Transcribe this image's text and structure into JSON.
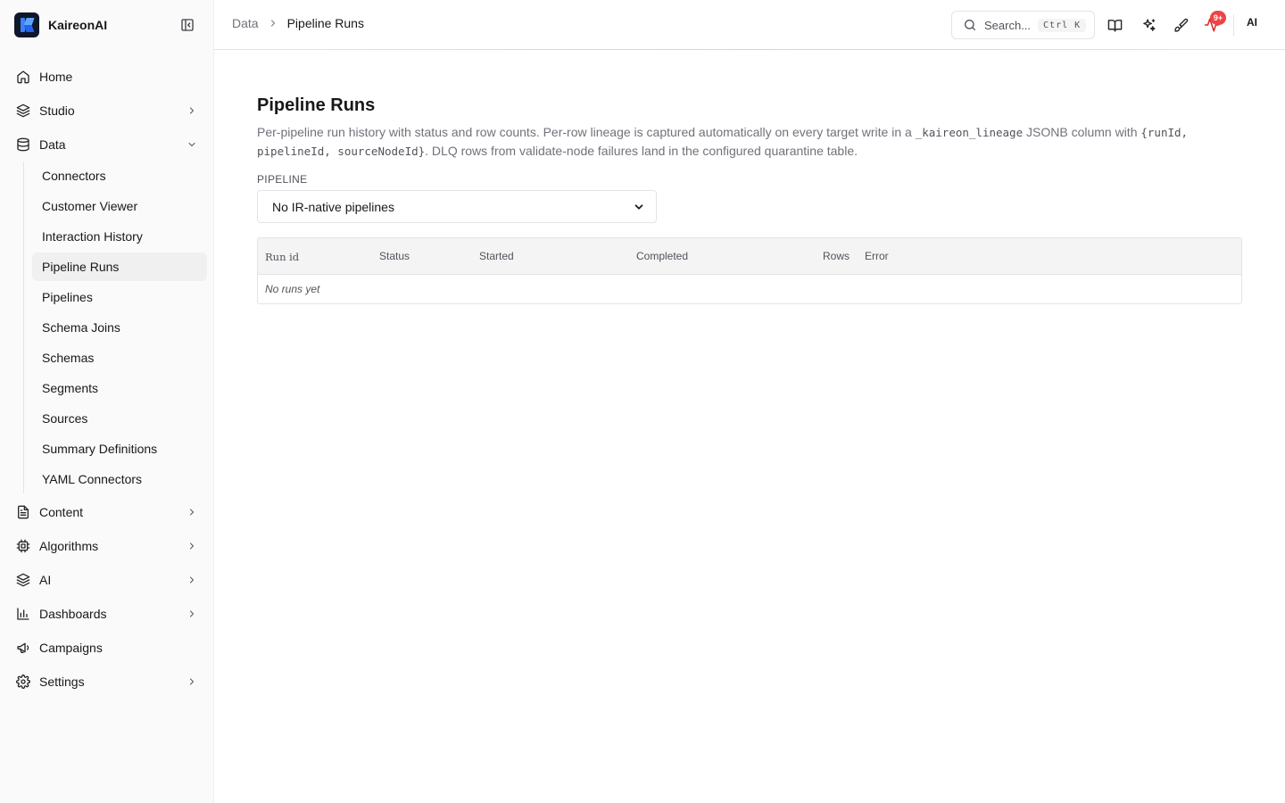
{
  "app": {
    "name": "KaireonAI"
  },
  "sidebar": {
    "items": [
      {
        "label": "Home"
      },
      {
        "label": "Studio"
      },
      {
        "label": "Data"
      },
      {
        "label": "Content"
      },
      {
        "label": "Algorithms"
      },
      {
        "label": "AI"
      },
      {
        "label": "Dashboards"
      },
      {
        "label": "Campaigns"
      },
      {
        "label": "Settings"
      }
    ],
    "data_subitems": [
      {
        "label": "Connectors"
      },
      {
        "label": "Customer Viewer"
      },
      {
        "label": "Interaction History"
      },
      {
        "label": "Pipeline Runs",
        "active": true
      },
      {
        "label": "Pipelines"
      },
      {
        "label": "Schema Joins"
      },
      {
        "label": "Schemas"
      },
      {
        "label": "Segments"
      },
      {
        "label": "Sources"
      },
      {
        "label": "Summary Definitions"
      },
      {
        "label": "YAML Connectors"
      }
    ]
  },
  "header": {
    "breadcrumb": {
      "parent": "Data",
      "current": "Pipeline Runs"
    },
    "search": {
      "placeholder": "Search...",
      "shortcut": "Ctrl K"
    },
    "notifications_badge": "9+",
    "ai_label": "AI"
  },
  "main": {
    "title": "Pipeline Runs",
    "description": {
      "p1": "Per-pipeline run history with status and row counts. Per-row lineage is captured automatically on every target write in a ",
      "c1": "_kaireon_lineage",
      "p2": " JSONB column with ",
      "c2": "{runId, pipelineId, sourceNodeId}",
      "p3": ". DLQ rows from validate-node failures land in the configured quarantine table."
    },
    "pipeline_label": "PIPELINE",
    "pipeline_select_value": "No IR-native pipelines",
    "table": {
      "columns": [
        "Run id",
        "Status",
        "Started",
        "Completed",
        "Rows",
        "Error"
      ],
      "empty_text": "No runs yet"
    }
  },
  "colors": {
    "accent": "#3b82f6",
    "badge": "#ef4444",
    "pulse": "#dc2626"
  }
}
